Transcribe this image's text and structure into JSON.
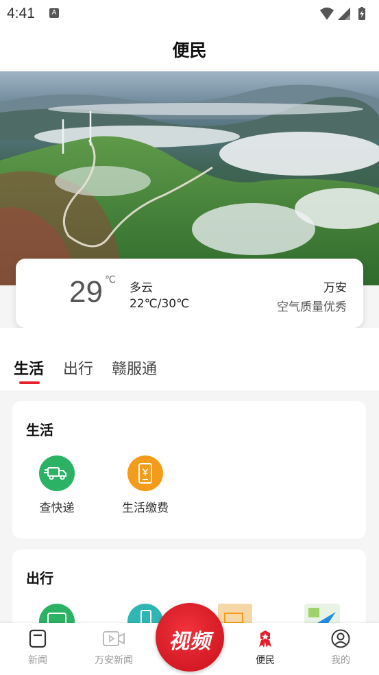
{
  "status_bar": {
    "time": "4:41",
    "notification_badge": "A"
  },
  "header": {
    "title": "便民"
  },
  "weather": {
    "temperature": "29",
    "unit": "℃",
    "condition": "多云",
    "range": "22℃/30℃",
    "city": "万安",
    "air_quality": "空气质量优秀"
  },
  "tabs": [
    {
      "label": "生活",
      "active": true
    },
    {
      "label": "出行",
      "active": false
    },
    {
      "label": "赣服通",
      "active": false
    }
  ],
  "sections": {
    "life": {
      "title": "生活",
      "items": [
        {
          "label": "查快递",
          "icon": "delivery-truck-icon",
          "color": "#2bb264"
        },
        {
          "label": "生活缴费",
          "icon": "phone-payment-icon",
          "color": "#f39c1b"
        }
      ]
    },
    "travel": {
      "title": "出行"
    }
  },
  "bottom_nav": {
    "news": "新闻",
    "wanan_news": "万安新闻",
    "video": "视频",
    "convenience": "便民",
    "mine": "我的"
  },
  "colors": {
    "accent": "#e51f2b",
    "green": "#2bb264",
    "orange": "#f39c1b",
    "teal": "#2fb6b4"
  }
}
